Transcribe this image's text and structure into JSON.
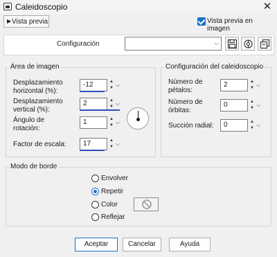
{
  "window": {
    "title": "Caleidoscopio",
    "close_glyph": "✕"
  },
  "preview_toggle": {
    "label": "Vista previa",
    "arrow": "▶"
  },
  "preview_checkbox": {
    "label": "Vista previa en imagen",
    "checked": true
  },
  "config": {
    "label": "Configuración",
    "value": "",
    "chevron": "⌵"
  },
  "image_area": {
    "title": "Área de imagen",
    "h_offset": {
      "label": "Desplazamiento\nhorizontal (%):",
      "value": "-12"
    },
    "v_offset": {
      "label": "Desplazamiento\nvertical (%):",
      "value": "2"
    },
    "rotation": {
      "label": "Ángulo de\nrotación:",
      "value": "1"
    },
    "scale": {
      "label": "Factor de escala:",
      "value": "17"
    }
  },
  "kaleido_config": {
    "title": "Configuración del caleidoscopio",
    "petals": {
      "label": "Número de\npétalos:",
      "value": "2"
    },
    "orbits": {
      "label": "Número de\nórbitas:",
      "value": "0"
    },
    "suction": {
      "label": "Succión radial:",
      "value": "0"
    }
  },
  "border_mode": {
    "title": "Modo de borde",
    "options": [
      "Envolver",
      "Repetir",
      "Color",
      "Reflejar"
    ],
    "selected": "Repetir"
  },
  "buttons": {
    "accept": "Aceptar",
    "cancel": "Cancelar",
    "help": "Ayuda"
  },
  "colors": {
    "accent": "#1a6fc9",
    "slider_bar": "#2a4fbf"
  },
  "icons": [
    "app-icon",
    "save-icon",
    "preset-icon",
    "manage-presets-icon",
    "no-color-icon"
  ]
}
